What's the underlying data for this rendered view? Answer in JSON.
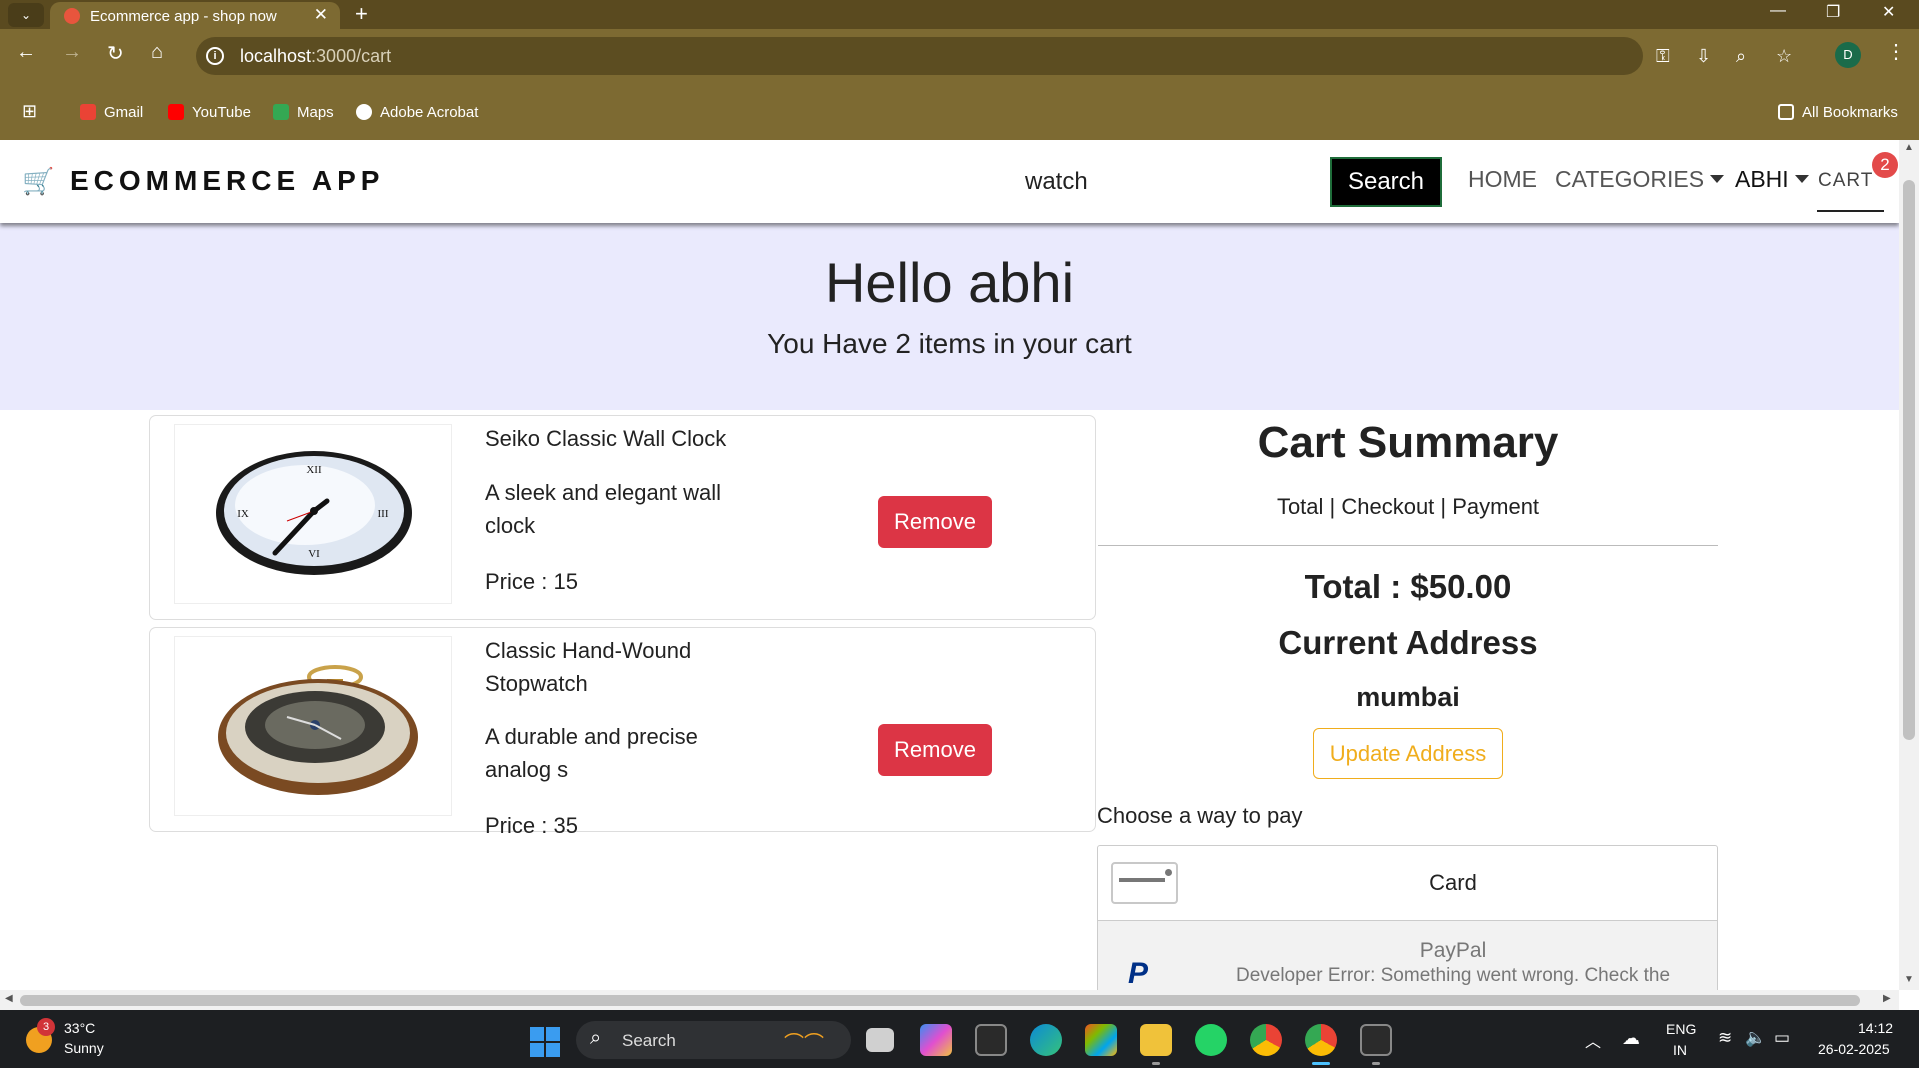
{
  "browser": {
    "tab_title": "Ecommerce app - shop now",
    "url_host": "localhost",
    "url_path": ":3000/cart",
    "profile_initial": "D",
    "bookmarks": [
      "Gmail",
      "YouTube",
      "Maps",
      "Adobe Acrobat"
    ],
    "all_bookmarks": "All Bookmarks"
  },
  "navbar": {
    "brand": "ECOMMERCE APP",
    "search_value": "watch",
    "search_button": "Search",
    "home": "HOME",
    "categories": "CATEGORIES",
    "user": "ABHI",
    "cart": "CART",
    "cart_count": "2"
  },
  "hero": {
    "greeting": "Hello abhi",
    "subtitle": "You Have 2 items in your cart"
  },
  "cart_items": [
    {
      "name": "Seiko Classic Wall Clock",
      "description": "A sleek and elegant wall clock",
      "price": "Price : 15",
      "remove_label": "Remove",
      "image": "wall-clock"
    },
    {
      "name": "Classic Hand-Wound Stopwatch",
      "description": "A durable and precise analog s",
      "price": "Price : 35",
      "remove_label": "Remove",
      "image": "pocket-watch"
    }
  ],
  "summary": {
    "title": "Cart Summary",
    "subtitle": "Total | Checkout | Payment",
    "total": "Total : $50.00",
    "address_heading": "Current Address",
    "address": "mumbai",
    "update_address": "Update Address",
    "pay_label": "Choose a way to pay",
    "card_label": "Card",
    "paypal_label": "PayPal",
    "paypal_error": "Developer Error: Something went wrong. Check the"
  },
  "taskbar": {
    "temperature": "33°C",
    "condition": "Sunny",
    "weather_badge": "3",
    "search": "Search",
    "lang1": "ENG",
    "lang2": "IN",
    "time": "14:12",
    "date": "26-02-2025"
  },
  "colors": {
    "hero_bg": "#eaeafd",
    "remove": "#dc3545",
    "update": "#f0ad1c",
    "chrome": "#7d6a32"
  }
}
